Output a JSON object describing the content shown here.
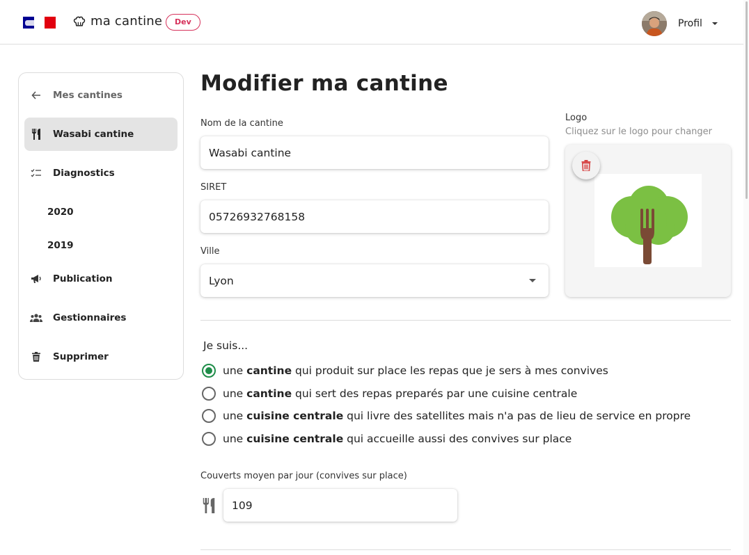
{
  "header": {
    "brand_name": "ma cantine",
    "env_badge": "Dev",
    "profile_label": "Profil"
  },
  "sidebar": {
    "back_label": "Mes cantines",
    "items": [
      {
        "label": "Wasabi cantine",
        "icon": "utensils-icon",
        "active": true
      },
      {
        "label": "Diagnostics",
        "icon": "checklist-icon"
      },
      {
        "label": "2020"
      },
      {
        "label": "2019"
      },
      {
        "label": "Publication",
        "icon": "megaphone-icon"
      },
      {
        "label": "Gestionnaires",
        "icon": "people-icon"
      },
      {
        "label": "Supprimer",
        "icon": "trash-icon"
      }
    ]
  },
  "main": {
    "title": "Modifier ma cantine",
    "name": {
      "label": "Nom de la cantine",
      "value": "Wasabi cantine"
    },
    "siret": {
      "label": "SIRET",
      "value": "05726932768158"
    },
    "city": {
      "label": "Ville",
      "value": "Lyon"
    },
    "logo": {
      "label": "Logo",
      "hint": "Cliquez sur le logo pour changer"
    },
    "type_question": "Je suis...",
    "type_options": [
      {
        "pre": "une ",
        "bold": "cantine",
        "post": " qui produit sur place les repas que je sers à mes convives",
        "checked": true
      },
      {
        "pre": "une ",
        "bold": "cantine",
        "post": " qui sert des repas preparés par une cuisine centrale",
        "checked": false
      },
      {
        "pre": "une ",
        "bold": "cuisine centrale",
        "post": " qui livre des satellites mais n'a pas de lieu de service en propre",
        "checked": false
      },
      {
        "pre": "une ",
        "bold": "cuisine centrale",
        "post": " qui accueille aussi des convives sur place",
        "checked": false
      }
    ],
    "daily_covers": {
      "label": "Couverts moyen par jour (convives sur place)",
      "value": "109"
    }
  },
  "colors": {
    "accent_green": "#1f8d49",
    "dev_badge": "#d6315b",
    "delete_red": "#d64545",
    "logo_tree": "#7bc043",
    "logo_fork": "#7a4a35"
  }
}
